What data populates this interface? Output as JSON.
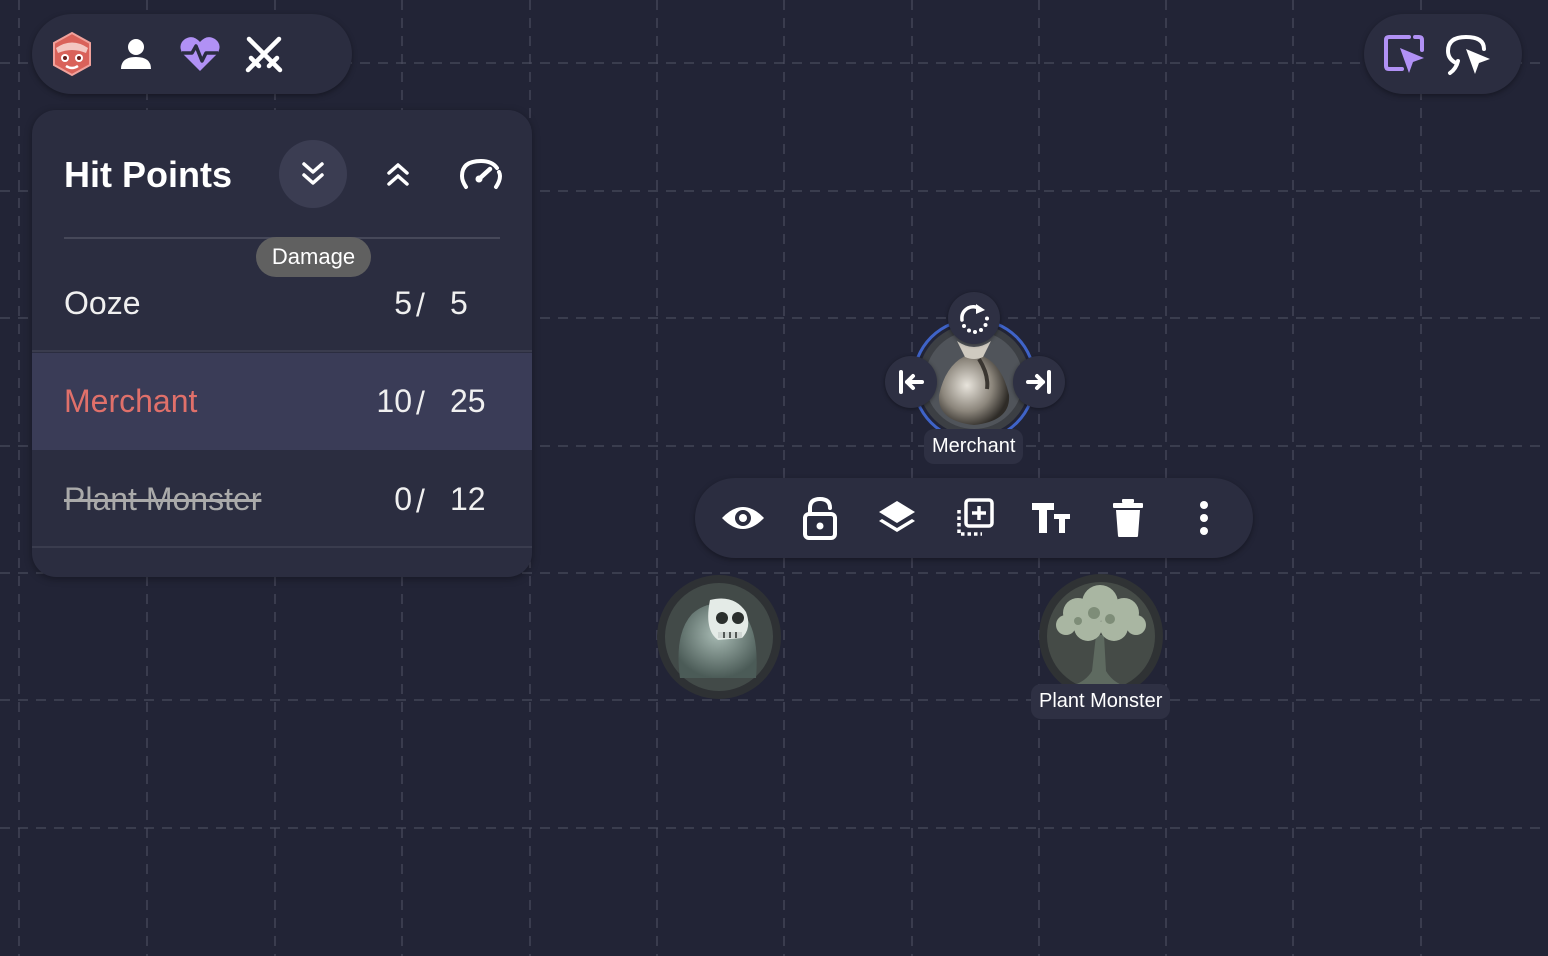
{
  "toolbar_left": {
    "icons": [
      "owlbear-logo-icon",
      "person-icon",
      "heart-pulse-icon",
      "crossed-swords-icon"
    ],
    "accent_color": "#b191f5"
  },
  "toolbar_right": {
    "icons": [
      "select-cursor-icon",
      "pointer-cursor-icon"
    ],
    "accent_color": "#b191f5"
  },
  "hit_points": {
    "title": "Hit Points",
    "damage_tooltip": "Damage",
    "rows": [
      {
        "name": "Ooze",
        "current": "5",
        "slash": "/",
        "max": "5"
      },
      {
        "name": "Merchant",
        "current": "10",
        "slash": "/",
        "max": "25"
      },
      {
        "name": "Plant Monster",
        "current": "0",
        "slash": "/",
        "max": "12"
      }
    ]
  },
  "tokens": {
    "merchant_label": "Merchant",
    "plant_label": "Plant Monster"
  },
  "token_toolbar": {
    "icons": [
      "eye-icon",
      "unlock-icon",
      "layers-icon",
      "duplicate-icon",
      "text-size-icon",
      "trash-icon",
      "more-vertical-icon"
    ]
  }
}
